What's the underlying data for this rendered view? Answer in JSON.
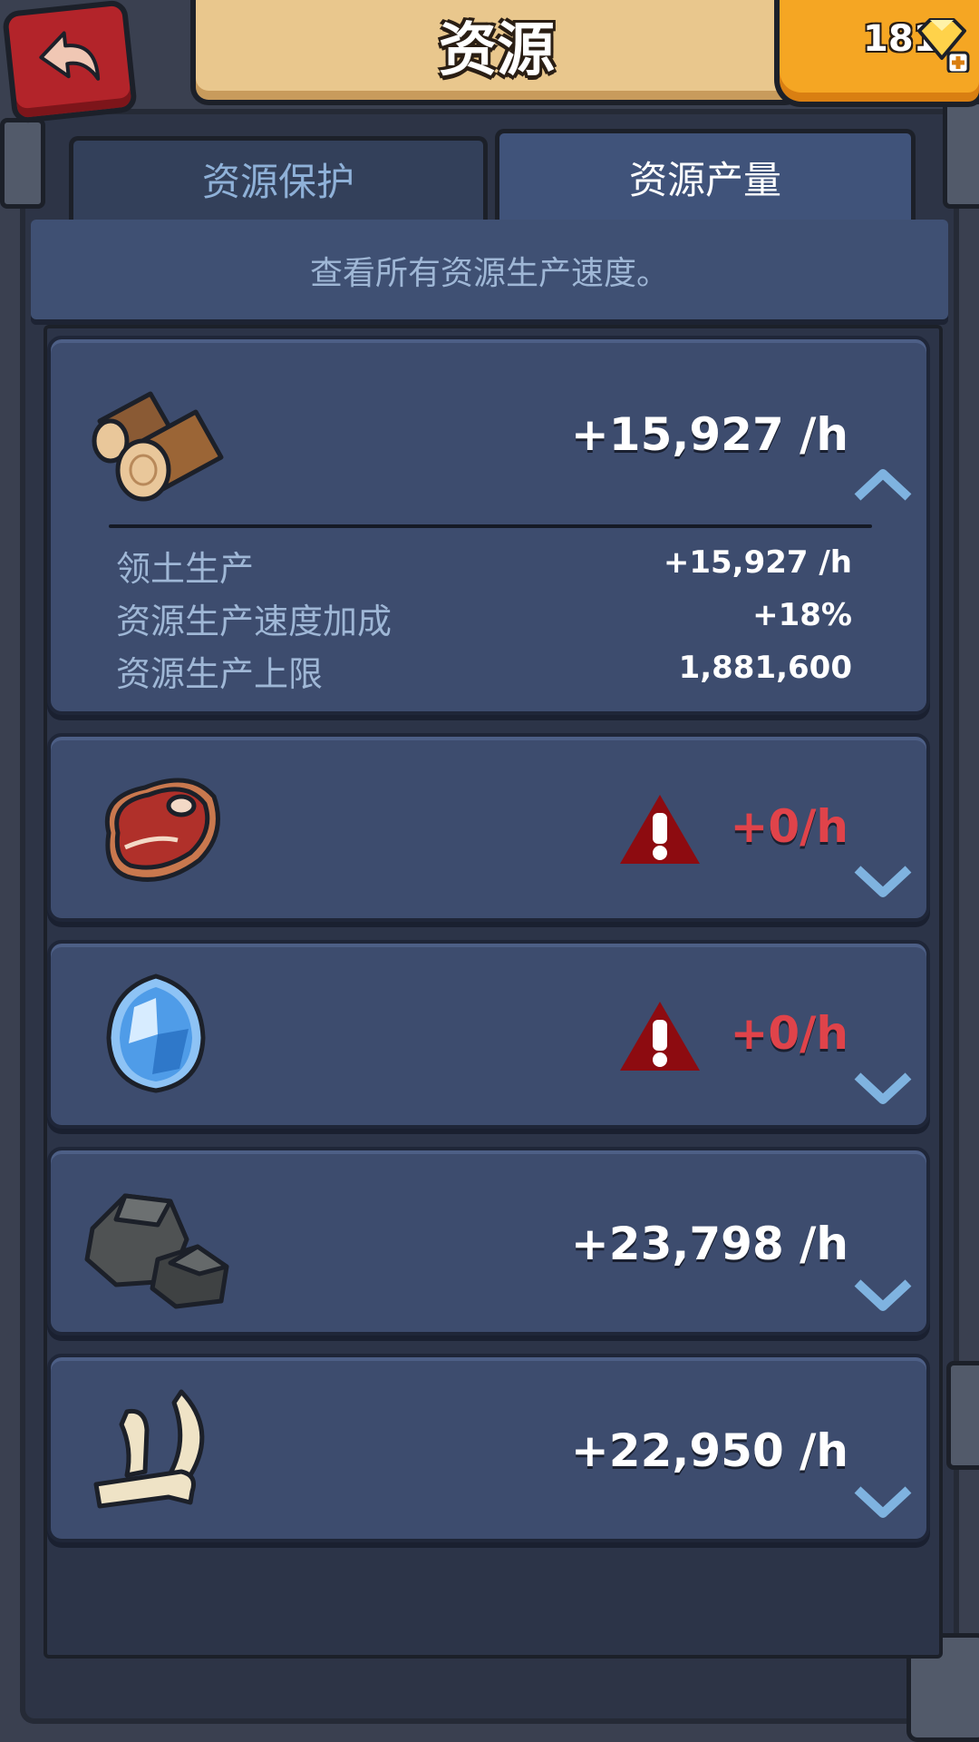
{
  "header": {
    "title": "资源",
    "gem_count": "181"
  },
  "tabs": [
    {
      "label": "资源保护",
      "active": false
    },
    {
      "label": "资源产量",
      "active": true
    }
  ],
  "description": "查看所有资源生产速度。",
  "resources": [
    {
      "icon": "wood-icon",
      "rate": "+15,927 /h",
      "expanded": true,
      "details": [
        {
          "label": "领土生产",
          "value": "+15,927 /h"
        },
        {
          "label": "资源生产速度加成",
          "value": "+18%"
        },
        {
          "label": "资源生产上限",
          "value": "1,881,600"
        }
      ]
    },
    {
      "icon": "meat-icon",
      "rate": "+0/h",
      "warning": true,
      "expanded": false
    },
    {
      "icon": "crystal-icon",
      "rate": "+0/h",
      "warning": true,
      "expanded": false
    },
    {
      "icon": "stone-icon",
      "rate": "+23,798 /h",
      "expanded": false
    },
    {
      "icon": "bone-icon",
      "rate": "+22,950 /h",
      "expanded": false
    }
  ],
  "colors": {
    "card_bg": "#3d4c6e",
    "warning_text": "#e0434a",
    "chevron": "#7fb3e0",
    "gem_box": "#f5a623",
    "back_button": "#b3242a"
  }
}
